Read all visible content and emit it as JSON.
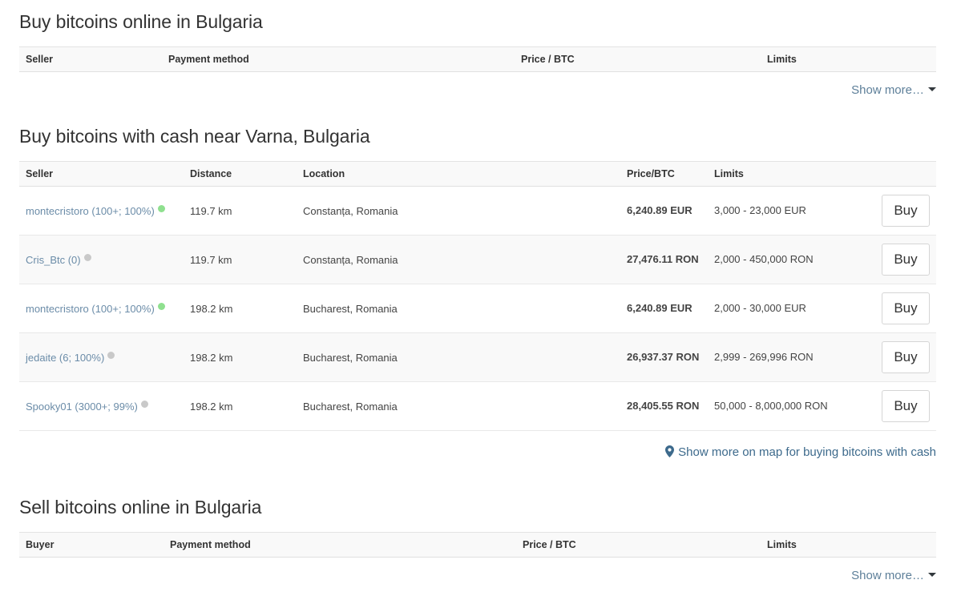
{
  "sections": {
    "buy_online": {
      "title": "Buy bitcoins online in Bulgaria",
      "columns": [
        "Seller",
        "Payment method",
        "Price / BTC",
        "Limits"
      ],
      "rows": [],
      "show_more_label": "Show more…"
    },
    "buy_cash": {
      "title": "Buy bitcoins with cash near Varna, Bulgaria",
      "columns": [
        "Seller",
        "Distance",
        "Location",
        "Price/BTC",
        "Limits"
      ],
      "rows": [
        {
          "seller": "montecristoro (100+; 100%)",
          "status": "online",
          "distance": "119.7 km",
          "location": "Constanța, Romania",
          "price": "6,240.89 EUR",
          "limits": "3,000 - 23,000 EUR",
          "action": "Buy"
        },
        {
          "seller": "Cris_Btc (0)",
          "status": "offline",
          "distance": "119.7 km",
          "location": "Constanța, Romania",
          "price": "27,476.11 RON",
          "limits": "2,000 - 450,000 RON",
          "action": "Buy"
        },
        {
          "seller": "montecristoro (100+; 100%)",
          "status": "online",
          "distance": "198.2 km",
          "location": "Bucharest, Romania",
          "price": "6,240.89 EUR",
          "limits": "2,000 - 30,000 EUR",
          "action": "Buy"
        },
        {
          "seller": "jedaite (6; 100%)",
          "status": "offline",
          "distance": "198.2 km",
          "location": "Bucharest, Romania",
          "price": "26,937.37 RON",
          "limits": "2,999 - 269,996 RON",
          "action": "Buy"
        },
        {
          "seller": "Spooky01 (3000+; 99%)",
          "status": "offline",
          "distance": "198.2 km",
          "location": "Bucharest, Romania",
          "price": "28,405.55 RON",
          "limits": "50,000 - 8,000,000 RON",
          "action": "Buy"
        }
      ],
      "map_link_label": "Show more on map for buying bitcoins with cash",
      "map_link_icon": "map-pin-icon"
    },
    "sell_online": {
      "title": "Sell bitcoins online in Bulgaria",
      "columns": [
        "Buyer",
        "Payment method",
        "Price / BTC",
        "Limits"
      ],
      "rows": [],
      "show_more_label": "Show more…"
    }
  },
  "colors": {
    "price_green": "#237a23",
    "link_blue": "#6b8ca8",
    "show_more_blue": "#5d7f99",
    "map_link_blue": "#3d6a8c",
    "status_online": "#8fe08f",
    "status_offline": "#c9c9c9",
    "header_bg": "#f9f9f9",
    "row_alt_bg": "#f9f9f9",
    "text": "#333333"
  }
}
